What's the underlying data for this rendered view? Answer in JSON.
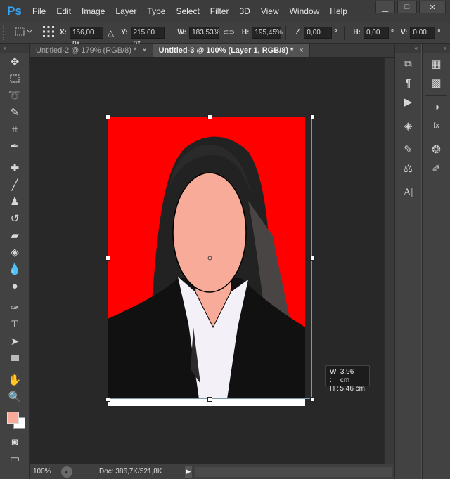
{
  "app": {
    "logo": "Ps"
  },
  "menu": [
    "File",
    "Edit",
    "Image",
    "Layer",
    "Type",
    "Select",
    "Filter",
    "3D",
    "View",
    "Window",
    "Help"
  ],
  "window_controls": {
    "minimize": "▁",
    "maximize": "□",
    "close": "✕"
  },
  "options": {
    "x_label": "X:",
    "x_value": "156,00 px",
    "y_label": "Y:",
    "y_value": "215,00 px",
    "w_label": "W:",
    "w_value": "183,53%",
    "h_label": "H:",
    "h_value": "195,45%",
    "angle_value": "0,00",
    "angle_unit": "°",
    "hskew_label": "H:",
    "hskew_value": "0,00",
    "vskew_label": "V:",
    "vskew_value": "0,00"
  },
  "tabs": [
    {
      "label": "Untitled-2 @ 179% (RGB/8) *",
      "close": "×"
    },
    {
      "label": "Untitled-3 @ 100% (Layer 1, RGB/8) *",
      "close": "×"
    }
  ],
  "tooltip": {
    "w_label": "W :",
    "w_value": "3,96 cm",
    "h_label": "H :",
    "h_value": "5,46 cm"
  },
  "status": {
    "zoom": "100%",
    "doc": "Doc: 386,7K/521,8K"
  },
  "colors": {
    "foreground": "#f7ab98",
    "background": "#ffffff",
    "canvas_red": "#ff0000",
    "skin": "#f7ab98"
  },
  "tools": [
    "move-icon",
    "marquee-icon",
    "lasso-icon",
    "quick-select-icon",
    "crop-icon",
    "eyedropper-icon",
    "healing-icon",
    "brush-icon",
    "stamp-icon",
    "history-brush-icon",
    "eraser-icon",
    "paint-bucket-icon",
    "blur-icon",
    "dodge-icon",
    "pen-icon",
    "type-icon",
    "path-select-icon",
    "shape-icon",
    "hand-icon",
    "zoom-icon"
  ]
}
